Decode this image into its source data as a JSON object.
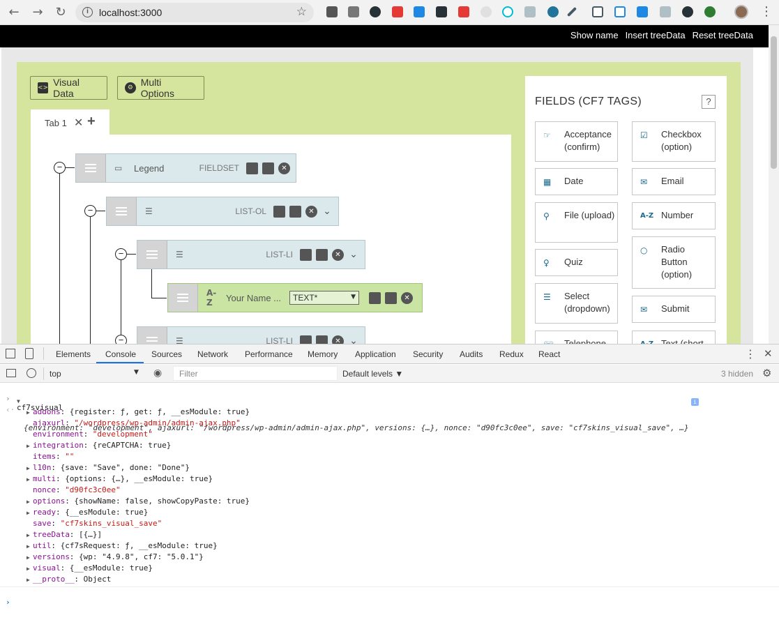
{
  "browser": {
    "url": "localhost:3000",
    "info_icon": "info-icon",
    "colors": {
      "ext1": "#c0392b",
      "ext2": "#2c3e50",
      "ext3": "#e53935",
      "ext4": "#1e88e5",
      "ext5": "#263238",
      "ext6": "#e53935",
      "ext7": "#9e9e9e",
      "ext8": "#00bcd4",
      "ext9": "#78909c",
      "ext10": "#21759b",
      "ext11": "#455a64",
      "ext12": "#455a64",
      "ext13": "#1e88e5",
      "ext14": "#1e88e5",
      "ext15": "#546e7a",
      "ext16": "#263238",
      "ext17": "#2e7d32"
    }
  },
  "topbar": {
    "show_name": "Show name",
    "insert_tree": "Insert treeData",
    "reset_tree": "Reset treeData"
  },
  "toolbar": {
    "visual_data": "Visual Data",
    "multi_options": "Multi Options"
  },
  "tab": {
    "label": "Tab 1",
    "close": "✕",
    "add": "+"
  },
  "tree": {
    "legend": {
      "name": "Legend",
      "type": "FIELDSET"
    },
    "list_ol": {
      "type": "LIST-OL"
    },
    "list_li": {
      "type": "LIST-LI"
    },
    "text_field": {
      "name": "Your Name ...",
      "select_value": "TEXT*"
    },
    "list_li_2": {
      "type": "LIST-LI"
    }
  },
  "fields_panel": {
    "title": "FIELDS (CF7 TAGS)",
    "help": "?",
    "items": [
      {
        "label": "Acceptance (confirm)",
        "icon": "hand-icon"
      },
      {
        "label": "Checkbox (option)",
        "icon": "checkbox-icon"
      },
      {
        "label": "Date",
        "icon": "calendar-icon"
      },
      {
        "label": "Email",
        "icon": "envelope-icon"
      },
      {
        "label": "File (upload)",
        "icon": "paperclip-icon"
      },
      {
        "label": "Number",
        "icon": "az-icon"
      },
      {
        "label": "Quiz",
        "icon": "lightbulb-icon"
      },
      {
        "label": "Radio Button (option)",
        "icon": "radio-icon"
      },
      {
        "label": "Select (dropdown)",
        "icon": "list-icon"
      },
      {
        "label": "Submit",
        "icon": "envelope-icon"
      },
      {
        "label": "Telephone",
        "icon": "phone-icon"
      },
      {
        "label": "Text (short",
        "icon": "az-icon"
      }
    ]
  },
  "devtools": {
    "tabs": [
      "Elements",
      "Console",
      "Sources",
      "Network",
      "Performance",
      "Memory",
      "Application",
      "Security",
      "Audits",
      "Redux",
      "React"
    ],
    "active_tab": "Console",
    "context": "top",
    "filter_placeholder": "Filter",
    "levels": "Default levels ▼",
    "hidden": "3 hidden",
    "command": "cf7svisual",
    "summary": "{environment: \"development\", ajaxurl: \"/wordpress/wp-admin/admin-ajax.php\", versions: {…}, nonce: \"d90fc3c0ee\", save: \"cf7skins_visual_save\", …}",
    "props": [
      {
        "expand": true,
        "key": "addons",
        "val": "{register: ƒ, get: ƒ, __esModule: true}"
      },
      {
        "expand": false,
        "key": "ajaxurl",
        "val": "\"/wordpress/wp-admin/admin-ajax.php\"",
        "str": true
      },
      {
        "expand": false,
        "key": "environment",
        "val": "\"development\"",
        "str": true
      },
      {
        "expand": true,
        "key": "integration",
        "val": "{reCAPTCHA: true}"
      },
      {
        "expand": false,
        "key": "items",
        "val": "\"\"",
        "str": true
      },
      {
        "expand": true,
        "key": "l10n",
        "val": "{save: \"Save\", done: \"Done\"}"
      },
      {
        "expand": true,
        "key": "multi",
        "val": "{options: {…}, __esModule: true}"
      },
      {
        "expand": false,
        "key": "nonce",
        "val": "\"d90fc3c0ee\"",
        "str": true
      },
      {
        "expand": true,
        "key": "options",
        "val": "{showName: false, showCopyPaste: true}"
      },
      {
        "expand": true,
        "key": "ready",
        "val": "{__esModule: true}"
      },
      {
        "expand": false,
        "key": "save",
        "val": "\"cf7skins_visual_save\"",
        "str": true
      },
      {
        "expand": true,
        "key": "treeData",
        "val": "[{…}]"
      },
      {
        "expand": true,
        "key": "util",
        "val": "{cf7sRequest: ƒ, __esModule: true}"
      },
      {
        "expand": true,
        "key": "versions",
        "val": "{wp: \"4.9.8\", cf7: \"5.0.1\"}"
      },
      {
        "expand": true,
        "key": "visual",
        "val": "{__esModule: true}"
      },
      {
        "expand": true,
        "key": "__proto__",
        "val": "Object",
        "grey": true
      }
    ]
  }
}
